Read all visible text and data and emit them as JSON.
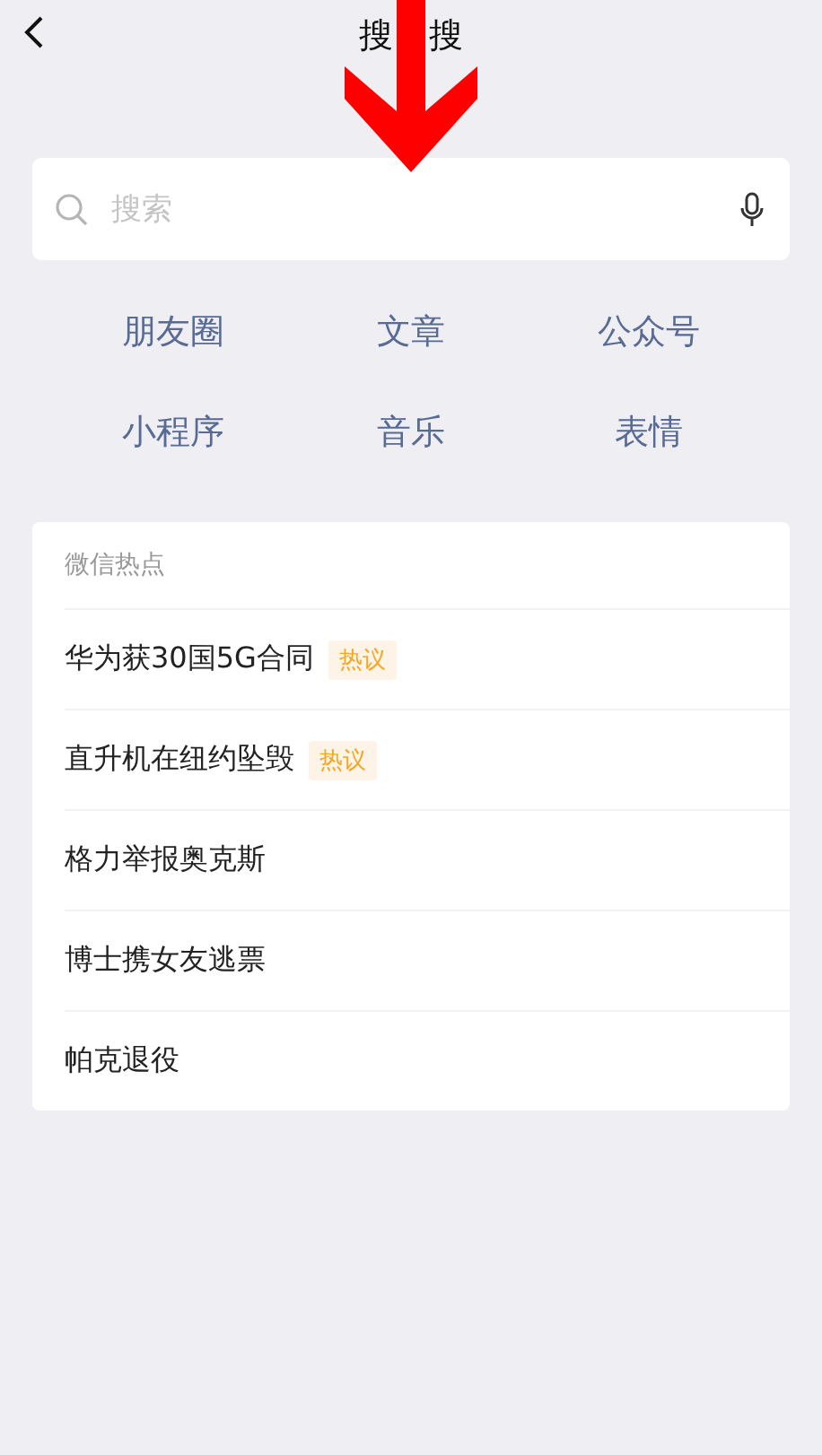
{
  "header": {
    "title_parts": [
      "搜",
      "搜"
    ]
  },
  "search": {
    "placeholder": "搜索"
  },
  "categories": [
    "朋友圈",
    "文章",
    "公众号",
    "小程序",
    "音乐",
    "表情"
  ],
  "hot": {
    "title": "微信热点",
    "items": [
      {
        "text": "华为获30国5G合同",
        "tag": "热议"
      },
      {
        "text": "直升机在纽约坠毁",
        "tag": "热议"
      },
      {
        "text": "格力举报奥克斯"
      },
      {
        "text": "博士携女友逃票"
      },
      {
        "text": "帕克退役"
      }
    ]
  }
}
